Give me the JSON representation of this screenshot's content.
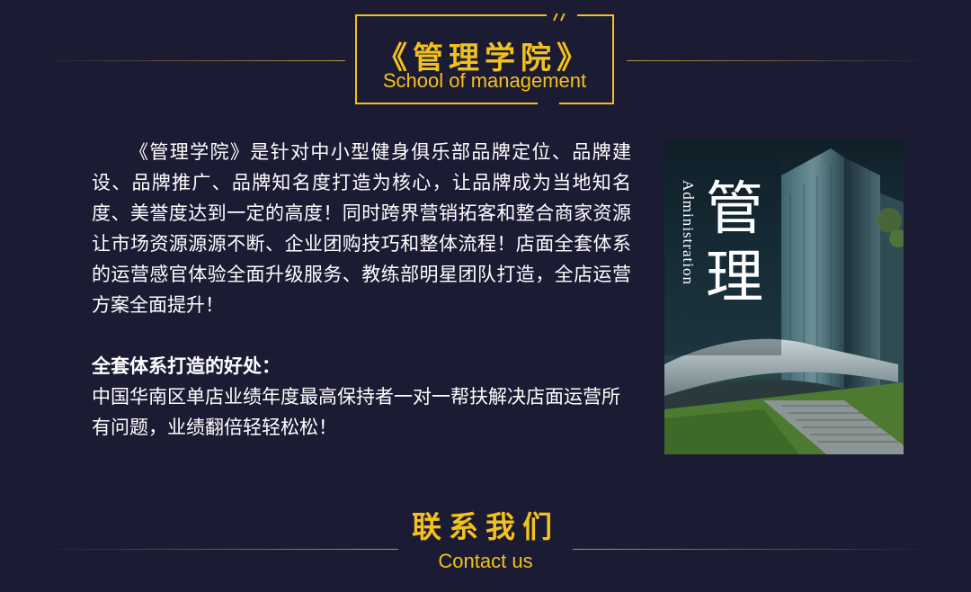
{
  "header": {
    "title_cn": "《管理学院》",
    "title_en": "School of management"
  },
  "intro": {
    "paragraph": "《管理学院》是针对中小型健身俱乐部品牌定位、品牌建设、品牌推广、品牌知名度打造为核心，让品牌成为当地知名度、美誉度达到一定的高度！同时跨界营销拓客和整合商家资源让市场资源源源不断、企业团购技巧和整体流程！店面全套体系的运营感官体验全面升级服务、教练部明星团队打造，全店运营方案全面提升！"
  },
  "benefits": {
    "heading": "全套体系打造的好处：",
    "text": "中国华南区单店业绩年度最高保持者一对一帮扶解决店面运营所有问题，业绩翻倍轻轻松松！"
  },
  "photo": {
    "char1": "管",
    "char2": "理",
    "label_en": "Administration"
  },
  "contact": {
    "title_cn": "联系我们",
    "title_en": "Contact us"
  },
  "colors": {
    "background": "#1c1b34",
    "accent": "#f2c21b",
    "text": "#ffffff"
  }
}
